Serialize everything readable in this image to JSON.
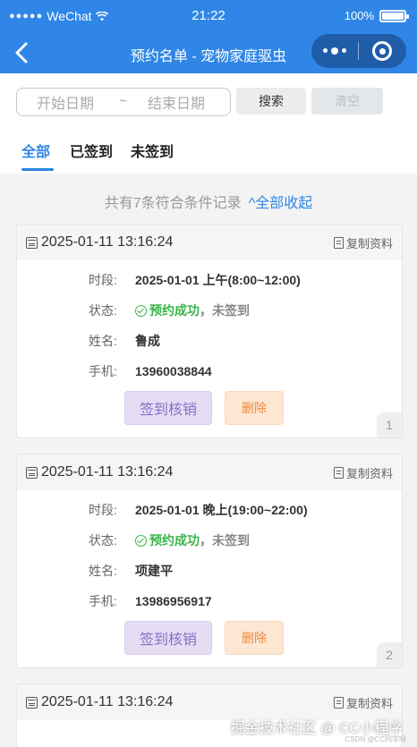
{
  "status_bar": {
    "carrier": "WeChat",
    "time": "21:22",
    "battery": "100%",
    "battery_level": 1.0
  },
  "nav": {
    "title": "预约名单 - 宠物家庭驱虫"
  },
  "filter": {
    "start_placeholder": "开始日期",
    "separator": "~",
    "end_placeholder": "结束日期",
    "search_label": "搜索",
    "clear_label": "清空"
  },
  "tabs": [
    {
      "label": "全部",
      "active": true
    },
    {
      "label": "已签到",
      "active": false
    },
    {
      "label": "未签到",
      "active": false
    }
  ],
  "summary": {
    "text": "共有7条符合条件记录",
    "collapse_label": "^全部收起"
  },
  "labels": {
    "slot": "时段:",
    "status": "状态:",
    "name": "姓名:",
    "phone": "手机:",
    "copy": "复制资料",
    "sign": "签到核销",
    "delete": "删除"
  },
  "records": [
    {
      "created": "2025-01-11 13:16:24",
      "slot": "2025-01-01 上午(8:00~12:00)",
      "status_ok": "预约成功",
      "status_rest": "，未签到",
      "name": "鲁成",
      "phone": "13960038844",
      "index": "1"
    },
    {
      "created": "2025-01-11 13:16:24",
      "slot": "2025-01-01 晚上(19:00~22:00)",
      "status_ok": "预约成功",
      "status_rest": "，未签到",
      "name": "项建平",
      "phone": "13986956917",
      "index": "2"
    },
    {
      "created": "2025-01-11 13:16:24"
    }
  ],
  "watermark": {
    "main": "掘金技术社区 @ CC小程序",
    "sub": "CSDN @CC同学呀"
  },
  "colors": {
    "primary": "#2f86e6",
    "success": "#3bb44a",
    "sign_button": "#e4ddf3",
    "delete_button": "#fde7d3"
  }
}
